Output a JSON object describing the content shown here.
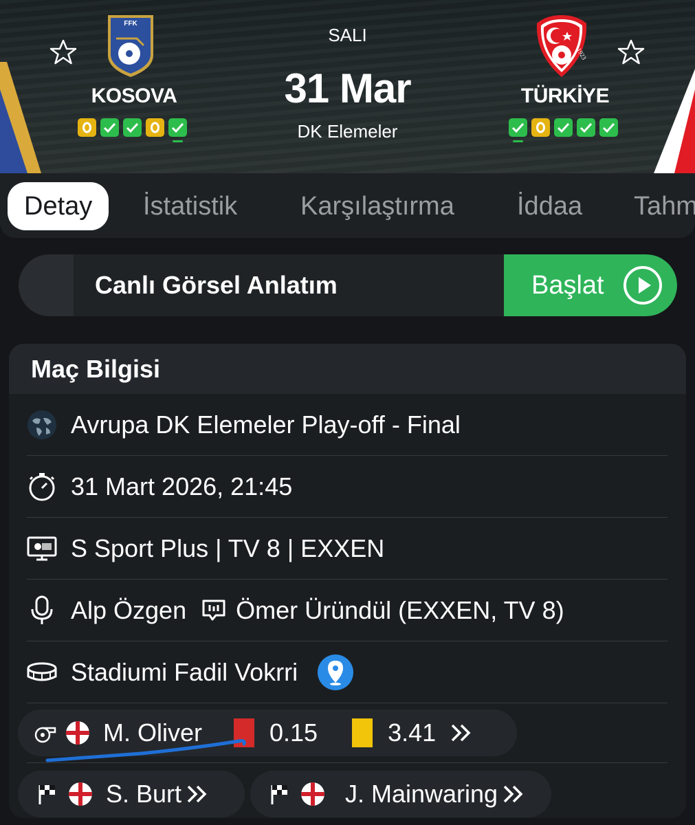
{
  "header": {
    "day": "SALI",
    "date": "31 Mar",
    "competition": "DK Elemeler",
    "home": {
      "name": "KOSOVA",
      "crest_text": "FFK",
      "form": [
        "D",
        "W",
        "W",
        "D",
        "W"
      ],
      "active_form_index": 4
    },
    "away": {
      "name": "TÜRKİYE",
      "crest_text": "1923",
      "form": [
        "W",
        "D",
        "W",
        "W",
        "W"
      ],
      "active_form_index": 0
    }
  },
  "tabs": [
    "Detay",
    "İstatistik",
    "Karşılaştırma",
    "İddaa",
    "Tahm"
  ],
  "active_tab": "Detay",
  "live": {
    "label": "Canlı Görsel Anlatım",
    "button_label": "Başlat"
  },
  "match_info": {
    "title": "Maç Bilgisi",
    "tournament": "Avrupa DK Elemeler Play-off - Final",
    "datetime": "31 Mart 2026, 21:45",
    "broadcast": "S Sport Plus | TV 8 | EXXEN",
    "commentator": "Alp Özgen",
    "commentator_alt": "Ömer Üründül (EXXEN, TV 8)",
    "stadium": "Stadiumi Fadil Vokrri",
    "referee": {
      "name": "M. Oliver",
      "red_avg": "0.15",
      "yellow_avg": "3.41"
    },
    "assistants": [
      "S. Burt",
      "J. Mainwaring"
    ]
  },
  "colors": {
    "win": "#2dbd4c",
    "draw": "#e5b312",
    "accent_green": "#2fb45a",
    "red_card": "#d42a2a",
    "yellow_card": "#f2c40a"
  },
  "icons": [
    "star-icon",
    "globe-icon",
    "stopwatch-icon",
    "tv-icon",
    "microphone-icon",
    "comment-icon",
    "stadium-icon",
    "location-pin-icon",
    "whistle-icon",
    "england-flag-icon",
    "corner-flag-icon",
    "double-chevron-icon",
    "play-icon"
  ]
}
